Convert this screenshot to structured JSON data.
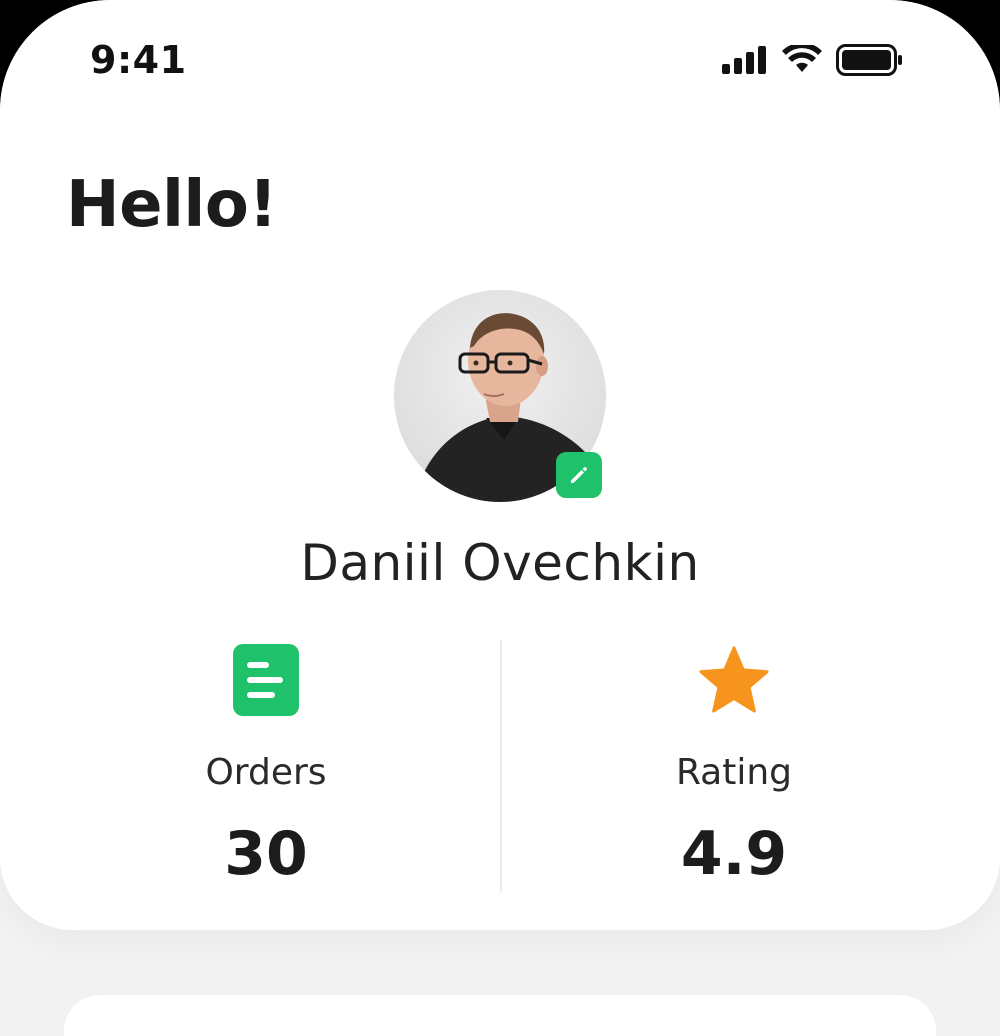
{
  "status_bar": {
    "time": "9:41"
  },
  "header": {
    "greeting": "Hello!"
  },
  "profile": {
    "name": "Daniil Ovechkin",
    "edit_icon": "pencil-icon",
    "avatar": "person-photo"
  },
  "stats": [
    {
      "label": "Orders",
      "value": "30",
      "icon": "orders-list-icon",
      "color": "#1fc26a"
    },
    {
      "label": "Rating",
      "value": "4.9",
      "icon": "star-icon",
      "color": "#f7941d"
    }
  ],
  "colors": {
    "accent": "#1fc26a",
    "star": "#f7941d"
  }
}
